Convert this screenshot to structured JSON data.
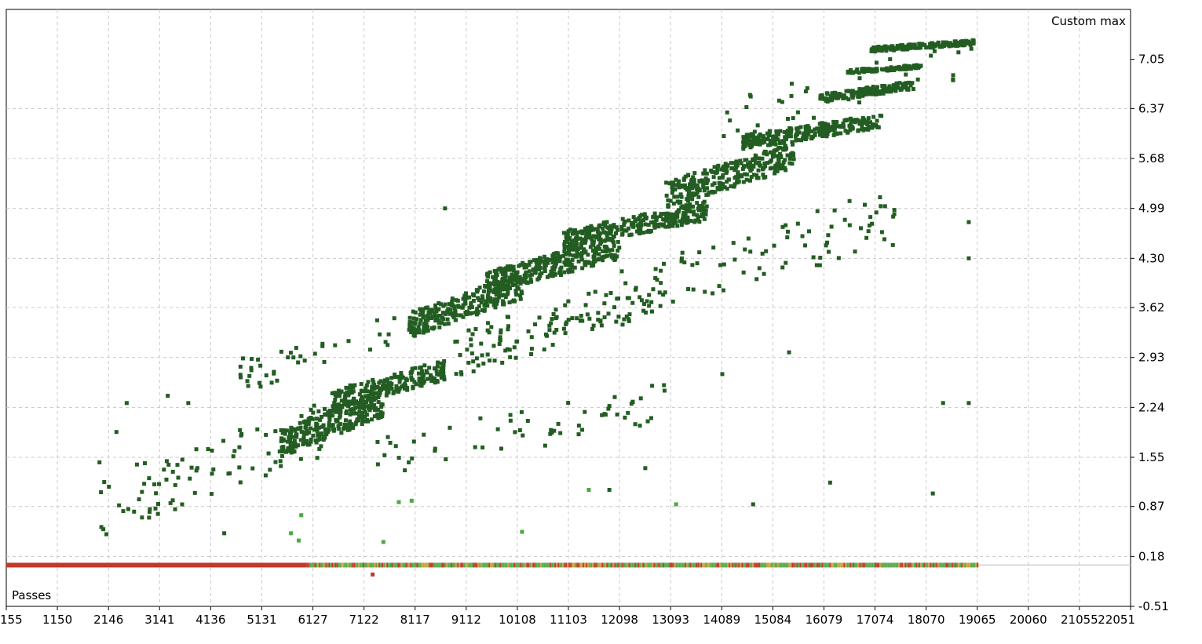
{
  "chart_data": {
    "type": "scatter",
    "title": "",
    "ylabel_corner": "Custom max",
    "xlabel_corner": "Passes",
    "x_ticks": [
      "155",
      "1150",
      "2146",
      "3141",
      "4136",
      "5131",
      "6127",
      "7122",
      "8117",
      "9112",
      "10108",
      "11103",
      "12098",
      "13093",
      "14089",
      "15084",
      "16079",
      "17074",
      "18070",
      "19065",
      "20060",
      "21055",
      "22051"
    ],
    "y_ticks": [
      "7.05",
      "6.37",
      "5.68",
      "4.99",
      "4.30",
      "3.62",
      "2.93",
      "2.24",
      "1.55",
      "0.87",
      "0.18",
      "-0.51"
    ],
    "xlim": [
      155,
      22051
    ],
    "ylim": [
      -0.51,
      7.74
    ],
    "grid": true,
    "colors": {
      "main": "#235d22",
      "light": "#4da844",
      "passes_loss": "#c0392b",
      "passes_mid": "#c9a23a",
      "passes_gain": "#57a94b",
      "grid": "#c8c8c8",
      "frame": "#000000"
    },
    "passes_bar": {
      "y": 0.06,
      "x_start": 155,
      "x_end": 19065,
      "red_until": 6000
    },
    "outlier_red": {
      "x": 7290,
      "y": -0.07
    },
    "bands": [
      {
        "x_from": 5500,
        "x_to": 7500,
        "y_from": 1.55,
        "y_to": 2.5,
        "count": 260
      },
      {
        "x_from": 6500,
        "x_to": 8700,
        "y_from": 2.2,
        "y_to": 2.9,
        "count": 220
      },
      {
        "x_from": 8000,
        "x_to": 10200,
        "y_from": 3.2,
        "y_to": 4.1,
        "count": 260
      },
      {
        "x_from": 9500,
        "x_to": 12100,
        "y_from": 3.8,
        "y_to": 4.6,
        "count": 300
      },
      {
        "x_from": 11000,
        "x_to": 13800,
        "y_from": 4.4,
        "y_to": 5.1,
        "count": 300
      },
      {
        "x_from": 13000,
        "x_to": 15500,
        "y_from": 5.0,
        "y_to": 5.9,
        "count": 280
      },
      {
        "x_from": 14500,
        "x_to": 17200,
        "y_from": 5.8,
        "y_to": 6.3,
        "count": 260
      },
      {
        "x_from": 16000,
        "x_to": 17800,
        "y_from": 6.45,
        "y_to": 6.75,
        "count": 140
      },
      {
        "x_from": 16500,
        "x_to": 18000,
        "y_from": 6.85,
        "y_to": 6.98,
        "count": 100
      },
      {
        "x_from": 17000,
        "x_to": 19000,
        "y_from": 7.15,
        "y_to": 7.32,
        "count": 160
      },
      {
        "x_from": 8800,
        "x_to": 13000,
        "y_from": 2.6,
        "y_to": 4.2,
        "count": 120
      },
      {
        "x_from": 12000,
        "x_to": 17500,
        "y_from": 3.3,
        "y_to": 5.3,
        "count": 90
      },
      {
        "x_from": 1800,
        "x_to": 6500,
        "y_from": 0.4,
        "y_to": 2.4,
        "count": 90
      },
      {
        "x_from": 4500,
        "x_to": 8000,
        "y_from": 2.4,
        "y_to": 3.6,
        "count": 40
      },
      {
        "x_from": 7000,
        "x_to": 13000,
        "y_from": 1.2,
        "y_to": 2.6,
        "count": 60
      },
      {
        "x_from": 14000,
        "x_to": 19000,
        "y_from": 5.9,
        "y_to": 7.4,
        "count": 40
      }
    ],
    "points": [
      {
        "x": 1970,
        "y": 1.48
      },
      {
        "x": 2300,
        "y": 1.9
      },
      {
        "x": 2500,
        "y": 2.3
      },
      {
        "x": 2700,
        "y": 1.45
      },
      {
        "x": 3300,
        "y": 2.4
      },
      {
        "x": 3700,
        "y": 2.3
      },
      {
        "x": 3400,
        "y": 1.35
      },
      {
        "x": 4400,
        "y": 0.5
      },
      {
        "x": 18400,
        "y": 2.3
      },
      {
        "x": 18900,
        "y": 2.3
      },
      {
        "x": 18900,
        "y": 4.3
      },
      {
        "x": 18900,
        "y": 4.8
      },
      {
        "x": 18200,
        "y": 1.05
      },
      {
        "x": 16200,
        "y": 1.2
      },
      {
        "x": 14700,
        "y": 0.9
      },
      {
        "x": 15400,
        "y": 3.0
      },
      {
        "x": 14100,
        "y": 2.7
      },
      {
        "x": 12600,
        "y": 1.4
      },
      {
        "x": 8700,
        "y": 4.99
      },
      {
        "x": 11900,
        "y": 1.1
      }
    ],
    "light_points": [
      {
        "x": 5700,
        "y": 0.5
      },
      {
        "x": 5850,
        "y": 0.4
      },
      {
        "x": 7500,
        "y": 0.38
      },
      {
        "x": 7800,
        "y": 0.93
      },
      {
        "x": 8050,
        "y": 0.95
      },
      {
        "x": 10200,
        "y": 0.52
      },
      {
        "x": 11500,
        "y": 1.1
      },
      {
        "x": 13200,
        "y": 0.9
      },
      {
        "x": 5900,
        "y": 0.75
      }
    ]
  }
}
